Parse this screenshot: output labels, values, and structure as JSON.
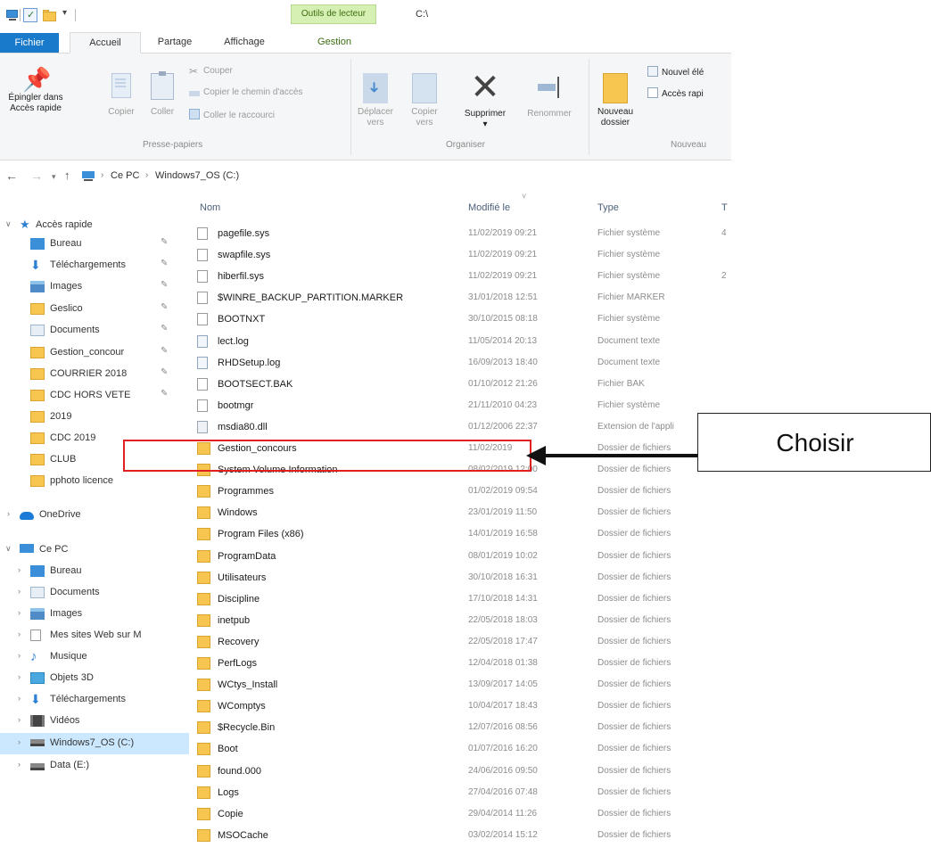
{
  "window": {
    "context_tab": "Outils de lecteur",
    "title": "C:\\"
  },
  "ribbon_tabs": [
    {
      "label": "Fichier"
    },
    {
      "label": "Accueil"
    },
    {
      "label": "Partage"
    },
    {
      "label": "Affichage"
    },
    {
      "label": "Gestion"
    }
  ],
  "ribbon": {
    "presse_papiers": {
      "group_label": "Presse-papiers",
      "pin_label_1": "Épingler dans",
      "pin_label_2": "Accès rapide",
      "copy_label": "Copier",
      "paste_label": "Coller",
      "cut_label": "Couper",
      "copy_path_label": "Copier le chemin d'accès",
      "paste_shortcut_label": "Coller le raccourci"
    },
    "organiser": {
      "group_label": "Organiser",
      "move_label_1": "Déplacer",
      "move_label_2": "vers",
      "copyto_label_1": "Copier",
      "copyto_label_2": "vers",
      "delete_label": "Supprimer",
      "rename_label": "Renommer"
    },
    "nouveau": {
      "group_label": "Nouveau",
      "new_folder_label_1": "Nouveau",
      "new_folder_label_2": "dossier",
      "new_item_label": "Nouvel élé",
      "quick_access_label": "Accès rapi"
    }
  },
  "address": {
    "crumbs": [
      "Ce PC",
      "Windows7_OS (C:)"
    ]
  },
  "nav_pane": {
    "quick_access": "Accès rapide",
    "quick_items": [
      {
        "label": "Bureau",
        "icon": "desktop-icon"
      },
      {
        "label": "Téléchargements",
        "icon": "download-icon"
      },
      {
        "label": "Images",
        "icon": "images-icon"
      },
      {
        "label": "Geslico",
        "icon": "folder-icon"
      },
      {
        "label": "Documents",
        "icon": "documents-icon"
      },
      {
        "label": "Gestion_concour",
        "icon": "folder-icon"
      },
      {
        "label": "COURRIER 2018",
        "icon": "folder-icon"
      },
      {
        "label": "CDC HORS VETE",
        "icon": "folder-icon"
      },
      {
        "label": "2019",
        "icon": "folder-icon"
      },
      {
        "label": "CDC 2019",
        "icon": "folder-icon"
      },
      {
        "label": "CLUB",
        "icon": "folder-icon"
      },
      {
        "label": "pphoto licence",
        "icon": "folder-icon"
      }
    ],
    "onedrive": "OneDrive",
    "this_pc": "Ce PC",
    "pc_items": [
      {
        "label": "Bureau",
        "icon": "desktop-icon"
      },
      {
        "label": "Documents",
        "icon": "documents-icon"
      },
      {
        "label": "Images",
        "icon": "images-icon"
      },
      {
        "label": "Mes sites Web sur M",
        "icon": "file-icon"
      },
      {
        "label": "Musique",
        "icon": "music-icon"
      },
      {
        "label": "Objets 3D",
        "icon": "3d-objects-icon"
      },
      {
        "label": "Téléchargements",
        "icon": "download-icon"
      },
      {
        "label": "Vidéos",
        "icon": "videos-icon"
      },
      {
        "label": "Windows7_OS (C:)",
        "icon": "drive-icon"
      },
      {
        "label": "Data (E:)",
        "icon": "drive-icon"
      }
    ]
  },
  "columns": {
    "name": "Nom",
    "modified": "Modifié le",
    "type": "Type",
    "size": "T"
  },
  "files": [
    {
      "name": "pagefile.sys",
      "date": "11/02/2019 09:21",
      "type": "Fichier système",
      "size": "4",
      "kind": "file"
    },
    {
      "name": "swapfile.sys",
      "date": "11/02/2019 09:21",
      "type": "Fichier système",
      "size": "",
      "kind": "file"
    },
    {
      "name": "hiberfil.sys",
      "date": "11/02/2019 09:21",
      "type": "Fichier système",
      "size": "2",
      "kind": "file"
    },
    {
      "name": "$WINRE_BACKUP_PARTITION.MARKER",
      "date": "31/01/2018 12:51",
      "type": "Fichier MARKER",
      "size": "",
      "kind": "file"
    },
    {
      "name": "BOOTNXT",
      "date": "30/10/2015 08:18",
      "type": "Fichier système",
      "size": "",
      "kind": "file"
    },
    {
      "name": "lect.log",
      "date": "11/05/2014 20:13",
      "type": "Document texte",
      "size": "",
      "kind": "text"
    },
    {
      "name": "RHDSetup.log",
      "date": "16/09/2013 18:40",
      "type": "Document texte",
      "size": "",
      "kind": "text"
    },
    {
      "name": "BOOTSECT.BAK",
      "date": "01/10/2012 21:26",
      "type": "Fichier BAK",
      "size": "",
      "kind": "file"
    },
    {
      "name": "bootmgr",
      "date": "21/11/2010 04:23",
      "type": "Fichier système",
      "size": "",
      "kind": "file"
    },
    {
      "name": "msdia80.dll",
      "date": "01/12/2006 22:37",
      "type": "Extension de l'appli",
      "size": "",
      "kind": "dll"
    },
    {
      "name": "Gestion_concours",
      "date": "11/02/2019",
      "type": "Dossier de fichiers",
      "size": "",
      "kind": "folder"
    },
    {
      "name": "System Volume Information",
      "date": "08/02/2019 12:00",
      "type": "Dossier de fichiers",
      "size": "",
      "kind": "folder"
    },
    {
      "name": "Programmes",
      "date": "01/02/2019 09:54",
      "type": "Dossier de fichiers",
      "size": "",
      "kind": "folder"
    },
    {
      "name": "Windows",
      "date": "23/01/2019 11:50",
      "type": "Dossier de fichiers",
      "size": "",
      "kind": "folder"
    },
    {
      "name": "Program Files (x86)",
      "date": "14/01/2019 16:58",
      "type": "Dossier de fichiers",
      "size": "",
      "kind": "folder"
    },
    {
      "name": "ProgramData",
      "date": "08/01/2019 10:02",
      "type": "Dossier de fichiers",
      "size": "",
      "kind": "folder"
    },
    {
      "name": "Utilisateurs",
      "date": "30/10/2018 16:31",
      "type": "Dossier de fichiers",
      "size": "",
      "kind": "folder"
    },
    {
      "name": "Discipline",
      "date": "17/10/2018 14:31",
      "type": "Dossier de fichiers",
      "size": "",
      "kind": "folder"
    },
    {
      "name": "inetpub",
      "date": "22/05/2018 18:03",
      "type": "Dossier de fichiers",
      "size": "",
      "kind": "folder"
    },
    {
      "name": "Recovery",
      "date": "22/05/2018 17:47",
      "type": "Dossier de fichiers",
      "size": "",
      "kind": "folder"
    },
    {
      "name": "PerfLogs",
      "date": "12/04/2018 01:38",
      "type": "Dossier de fichiers",
      "size": "",
      "kind": "folder"
    },
    {
      "name": "WCtys_Install",
      "date": "13/09/2017 14:05",
      "type": "Dossier de fichiers",
      "size": "",
      "kind": "folder"
    },
    {
      "name": "WComptys",
      "date": "10/04/2017 18:43",
      "type": "Dossier de fichiers",
      "size": "",
      "kind": "folder"
    },
    {
      "name": "$Recycle.Bin",
      "date": "12/07/2016 08:56",
      "type": "Dossier de fichiers",
      "size": "",
      "kind": "folder"
    },
    {
      "name": "Boot",
      "date": "01/07/2016 16:20",
      "type": "Dossier de fichiers",
      "size": "",
      "kind": "folder"
    },
    {
      "name": "found.000",
      "date": "24/06/2016 09:50",
      "type": "Dossier de fichiers",
      "size": "",
      "kind": "folder"
    },
    {
      "name": "Logs",
      "date": "27/04/2016 07:48",
      "type": "Dossier de fichiers",
      "size": "",
      "kind": "folder"
    },
    {
      "name": "Copie",
      "date": "29/04/2014 11:26",
      "type": "Dossier de fichiers",
      "size": "",
      "kind": "folder"
    },
    {
      "name": "MSOCache",
      "date": "03/02/2014 15:12",
      "type": "Dossier de fichiers",
      "size": "",
      "kind": "folder"
    }
  ],
  "annotation": {
    "callout_text": "Choisir",
    "highlight_color": "#e02020"
  },
  "colors": {
    "file_tab": "#1979ca",
    "context_tab_bg": "#d6f0b4",
    "folder": "#f6c650",
    "selected": "#cce8ff"
  }
}
